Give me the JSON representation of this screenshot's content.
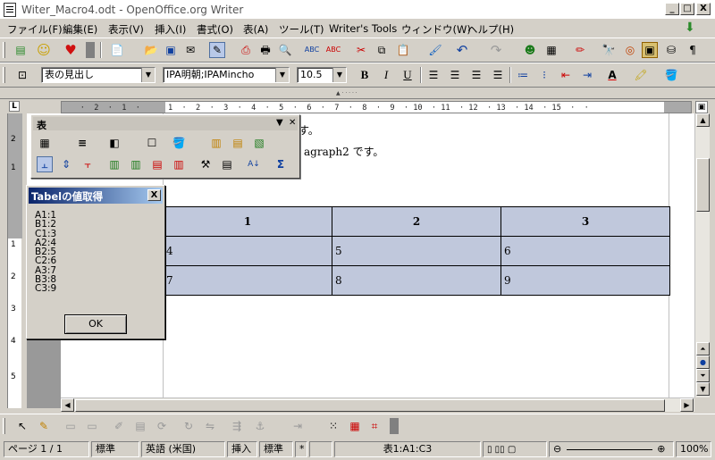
{
  "window": {
    "title": "Witer_Macro4.odt - OpenOffice.org Writer",
    "min": "_",
    "max": "□",
    "close": "X"
  },
  "menu": [
    "ファイル(F)",
    "編集(E)",
    "表示(V)",
    "挿入(I)",
    "書式(O)",
    "表(A)",
    "ツール(T)",
    "Writer's Tools",
    "ウィンドウ(W)",
    "ヘルプ(H)"
  ],
  "format": {
    "style": "表の見出し",
    "font": "IPA明朝;IPAMincho",
    "size": "10.5",
    "bold": "B",
    "italic": "I",
    "underline": "U"
  },
  "ruler": {
    "corner": "L",
    "ticks": "    ·  2  ·  1  ·      1  ·  2  ·  3  ·  4  ·  5  ·  6  ·  7  ·  8  ·  9  · 10  · 11  · 12  · 13  · 14  · 15  ·  ·"
  },
  "vruler": [
    "2",
    "1",
    "1",
    "2",
    "3",
    "4",
    "5"
  ],
  "document": {
    "line1": "です。",
    "line2": "agraph2 です。",
    "table": [
      [
        "1",
        "2",
        "3"
      ],
      [
        "4",
        "5",
        "6"
      ],
      [
        "7",
        "8",
        "9"
      ]
    ]
  },
  "table_toolbar": {
    "title": "表"
  },
  "dialog": {
    "title": "Tabelの値取得",
    "close": "X",
    "lines": [
      "A1:1",
      "B1:2",
      "C1:3",
      "A2:4",
      "B2:5",
      "C2:6",
      "A3:7",
      "B3:8",
      "C3:9"
    ],
    "ok": "OK"
  },
  "status": {
    "page": "ページ 1 / 1",
    "style": "標準",
    "lang": "英語 (米国)",
    "mode": "挿入",
    "sel": "標準",
    "star": "*",
    "cell": "表1:A1:C3",
    "zoom": "100%"
  }
}
